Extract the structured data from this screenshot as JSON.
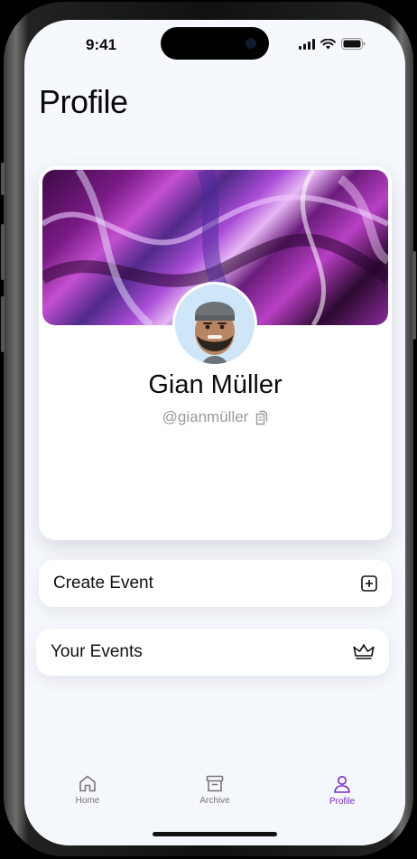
{
  "status_bar": {
    "time": "9:41"
  },
  "header": {
    "title": "Profile"
  },
  "profile": {
    "name": "Gian Müller",
    "handle": "@gianmüller"
  },
  "actions": [
    {
      "label": "Create Event",
      "icon": "plus-square-icon"
    },
    {
      "label": "Your Events",
      "icon": "crown-icon"
    }
  ],
  "tab_bar": {
    "items": [
      {
        "label": "Home",
        "icon": "home-icon",
        "active": false
      },
      {
        "label": "Archive",
        "icon": "archive-icon",
        "active": false
      },
      {
        "label": "Profile",
        "icon": "person-icon",
        "active": true
      }
    ]
  },
  "colors": {
    "accent": "#7a2bd1",
    "background": "#f5f8fd"
  }
}
